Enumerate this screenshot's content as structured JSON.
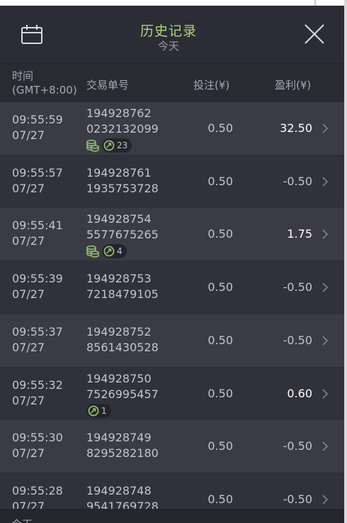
{
  "header": {
    "title": "历史记录",
    "subtitle": "今天"
  },
  "columns": {
    "time_line1": "时间",
    "time_line2": "(GMT+8:00)",
    "order_id": "交易单号",
    "bet": "投注(¥)",
    "profit": "盈利(¥)"
  },
  "rows": [
    {
      "time": "09:55:59",
      "date": "07/27",
      "id1": "194928762",
      "id2": "0232132099",
      "bet": "0.50",
      "profit": "32.50",
      "win": true,
      "coins": true,
      "badge_count": "23"
    },
    {
      "time": "09:55:57",
      "date": "07/27",
      "id1": "194928761",
      "id2": "1935753728",
      "bet": "0.50",
      "profit": "-0.50",
      "win": false,
      "coins": false,
      "badge_count": null
    },
    {
      "time": "09:55:41",
      "date": "07/27",
      "id1": "194928754",
      "id2": "5577675265",
      "bet": "0.50",
      "profit": "1.75",
      "win": true,
      "coins": true,
      "badge_count": "4"
    },
    {
      "time": "09:55:39",
      "date": "07/27",
      "id1": "194928753",
      "id2": "7218479105",
      "bet": "0.50",
      "profit": "-0.50",
      "win": false,
      "coins": false,
      "badge_count": null
    },
    {
      "time": "09:55:37",
      "date": "07/27",
      "id1": "194928752",
      "id2": "8561430528",
      "bet": "0.50",
      "profit": "-0.50",
      "win": false,
      "coins": false,
      "badge_count": null
    },
    {
      "time": "09:55:32",
      "date": "07/27",
      "id1": "194928750",
      "id2": "7526995457",
      "bet": "0.50",
      "profit": "0.60",
      "win": true,
      "coins": false,
      "badge_count": "1"
    },
    {
      "time": "09:55:30",
      "date": "07/27",
      "id1": "194928749",
      "id2": "8295282180",
      "bet": "0.50",
      "profit": "-0.50",
      "win": false,
      "coins": false,
      "badge_count": null
    },
    {
      "time": "09:55:28",
      "date": "07/27",
      "id1": "194928748",
      "id2": "9541769728",
      "bet": "0.50",
      "profit": "-0.50",
      "win": false,
      "coins": false,
      "badge_count": null
    }
  ],
  "footer": {
    "text": "今天"
  },
  "colors": {
    "title": "#a8d87a",
    "badge_icon": "#8fbf6a"
  },
  "icons": {
    "calendar": "calendar-icon",
    "close": "close-icon",
    "row_chevron": "chevron-right-icon",
    "coins": "coins-icon",
    "free_spin": "free-spin-icon"
  }
}
